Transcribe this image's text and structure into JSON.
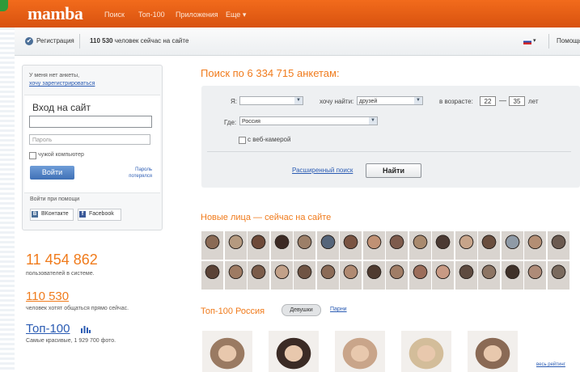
{
  "header": {
    "logo": "mamba",
    "nav": [
      "Поиск",
      "Топ-100",
      "Приложения",
      "Еще ▾"
    ]
  },
  "subbar": {
    "register": "Регистрация",
    "online_count": "110 530",
    "online_text": "человек сейчас на сайте",
    "help": "Помощь"
  },
  "login": {
    "no_profile": "У меня нет анкеты,",
    "register_link": "хочу зарегистрироваться",
    "title": "Вход на сайт",
    "login_value": "",
    "password_placeholder": "Пароль",
    "foreign_computer": "чужой компьютер",
    "submit": "Войти",
    "lost_password": "Пароль потерялся",
    "via": "Войти при помощи",
    "vk": "ВКонтакте",
    "facebook": "Facebook"
  },
  "stats": {
    "users_count": "11 454 862",
    "users_label": "пользователей в системе.",
    "chat_count": "110 530",
    "chat_label": "человек хотят общаться прямо сейчас.",
    "top100": "Топ-100",
    "top100_label": "Самые красивые, 1 929 700 фото."
  },
  "search": {
    "title": "Поиск по 6 334 715 анкетам:",
    "i_label": "Я:",
    "i_value": "",
    "want_label": "хочу найти:",
    "want_value": "друзей",
    "age_label": "в возрасте:",
    "age_from": "22",
    "age_to": "35",
    "years": "лет",
    "where_label": "Где:",
    "where_value": "Россия",
    "webcam": "с веб-камерой",
    "advanced": "Расширенный поиск",
    "find": "Найти"
  },
  "new_faces": {
    "title": "Новые лица — сейчас на сайте",
    "row1_colors": [
      "#8a6a55",
      "#b59a80",
      "#6e4a39",
      "#3c2a24",
      "#9c7f68",
      "#55657a",
      "#7a5442",
      "#c09174",
      "#7d5b4c",
      "#a98a6e",
      "#4b3a33",
      "#c7a48a",
      "#6a4e3e",
      "#8f9aa6",
      "#b38e74",
      "#6b5a50"
    ],
    "row2_colors": [
      "#5a4236",
      "#9e7b63",
      "#7b5c4a",
      "#c2a189",
      "#6f5444",
      "#8b6b57",
      "#b08a72",
      "#4f3b30",
      "#a07d66",
      "#9c6e5b",
      "#c89a84",
      "#5e4b40",
      "#8d7564",
      "#3f3129",
      "#ae8b78",
      "#7a6a5e"
    ]
  },
  "top100_section": {
    "title": "Топ-100 Россия",
    "girls_tab": "Девушки",
    "guys_tab": "Парни",
    "photo_colors": [
      "#9a7a62",
      "#3b2b25",
      "#c9a58a",
      "#d3bd9a",
      "#8a6a55"
    ],
    "all_rating": "весь рейтинг"
  }
}
